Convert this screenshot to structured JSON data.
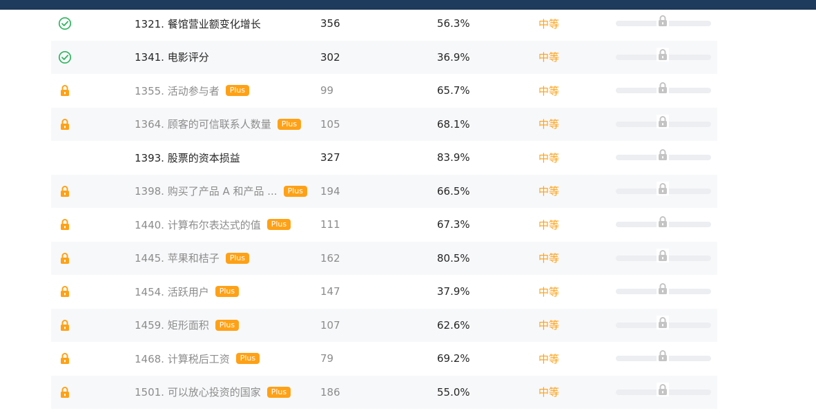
{
  "colors": {
    "accent": "#ffa116",
    "solved": "#2db55d",
    "header": "#1e3a5c",
    "lock_gray": "#c4c4c4"
  },
  "rows": [
    {
      "status": "solved",
      "title": "1321. 餐馆营业额变化增长",
      "plus": "",
      "submissions": "356",
      "rate": "56.3%",
      "difficulty": "中等"
    },
    {
      "status": "solved",
      "title": "1341. 电影评分",
      "plus": "",
      "submissions": "302",
      "rate": "36.9%",
      "difficulty": "中等"
    },
    {
      "status": "locked",
      "title": "1355. 活动参与者",
      "plus": "Plus",
      "submissions": "99",
      "rate": "65.7%",
      "difficulty": "中等"
    },
    {
      "status": "locked",
      "title": "1364. 顾客的可信联系人数量",
      "plus": "Plus",
      "submissions": "105",
      "rate": "68.1%",
      "difficulty": "中等"
    },
    {
      "status": "none",
      "title": "1393. 股票的资本损益",
      "plus": "",
      "submissions": "327",
      "rate": "83.9%",
      "difficulty": "中等"
    },
    {
      "status": "locked",
      "title": "1398. 购买了产品 A 和产品 ...",
      "plus": "Plus",
      "submissions": "194",
      "rate": "66.5%",
      "difficulty": "中等"
    },
    {
      "status": "locked",
      "title": "1440. 计算布尔表达式的值",
      "plus": "Plus",
      "submissions": "111",
      "rate": "67.3%",
      "difficulty": "中等"
    },
    {
      "status": "locked",
      "title": "1445. 苹果和桔子",
      "plus": "Plus",
      "submissions": "162",
      "rate": "80.5%",
      "difficulty": "中等"
    },
    {
      "status": "locked",
      "title": "1454. 活跃用户",
      "plus": "Plus",
      "submissions": "147",
      "rate": "37.9%",
      "difficulty": "中等"
    },
    {
      "status": "locked",
      "title": "1459. 矩形面积",
      "plus": "Plus",
      "submissions": "107",
      "rate": "62.6%",
      "difficulty": "中等"
    },
    {
      "status": "locked",
      "title": "1468. 计算税后工资",
      "plus": "Plus",
      "submissions": "79",
      "rate": "69.2%",
      "difficulty": "中等"
    },
    {
      "status": "locked",
      "title": "1501. 可以放心投资的国家",
      "plus": "Plus",
      "submissions": "186",
      "rate": "55.0%",
      "difficulty": "中等"
    }
  ]
}
